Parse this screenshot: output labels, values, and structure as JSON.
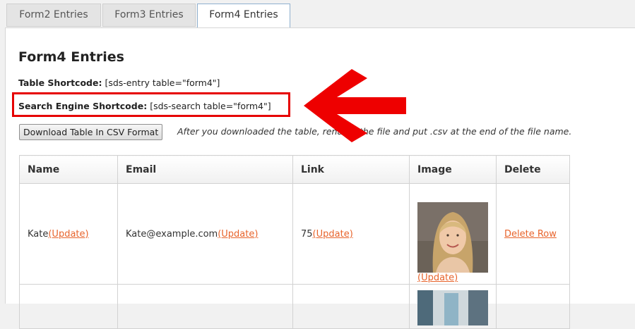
{
  "tabs": [
    {
      "label": "Form2 Entries",
      "active": false
    },
    {
      "label": "Form3 Entries",
      "active": false
    },
    {
      "label": "Form4 Entries",
      "active": true
    }
  ],
  "heading": "Form4 Entries",
  "table_shortcode": {
    "label": "Table Shortcode:",
    "value": "[sds-entry table=\"form4\"]"
  },
  "search_shortcode": {
    "label": "Search Engine Shortcode:",
    "value": "[sds-search table=\"form4\"]"
  },
  "csv_button": "Download Table In CSV Format",
  "csv_note": "After you downloaded the table, rename the file and put .csv at the end of the file name.",
  "columns": [
    "Name",
    "Email",
    "Link",
    "Image",
    "Delete"
  ],
  "rows": [
    {
      "name": "Kate",
      "email": "Kate@example.com",
      "link": "75",
      "update_label": "(Update)",
      "delete_label": "Delete Row"
    }
  ],
  "colors": {
    "accent_link": "#e8642c",
    "highlight": "#e60000"
  }
}
